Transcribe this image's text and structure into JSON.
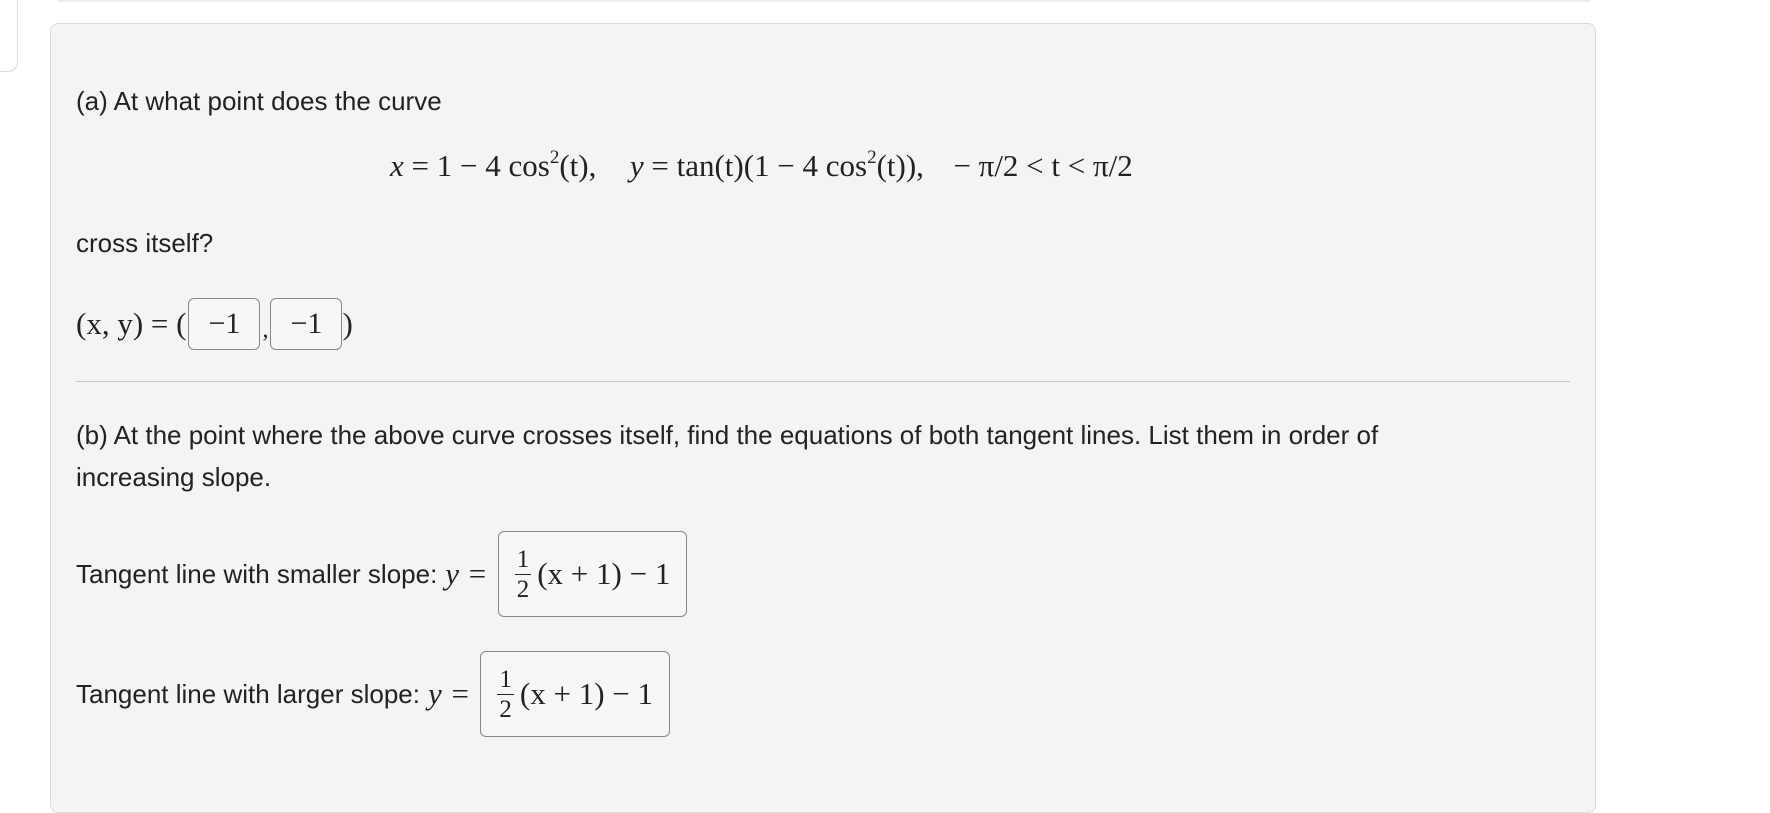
{
  "part_a": {
    "intro": "(a) At what point does the curve",
    "equation": {
      "x_lhs": "x",
      "x_rhs": "= 1 − 4 cos",
      "exp": "2",
      "arg": "(t),",
      "y_lhs": "y",
      "y_rhs": "= tan(t)(1 − 4 cos",
      "y_exp": "2",
      "y_tail": "(t)),",
      "range": "− π/2 < t < π/2"
    },
    "question_end": "cross itself?",
    "answer_label": "(x, y) = (",
    "answer_close": ")",
    "x_value": "−1",
    "separator": ",",
    "y_value": "−1"
  },
  "part_b": {
    "intro": "(b) At the point where the above curve crosses itself, find the equations of both tangent lines. List them in order of",
    "intro_line2": "increasing slope.",
    "smaller": {
      "label": "Tangent line with smaller slope:",
      "var": "y =",
      "frac_num": "1",
      "frac_den": "2",
      "expr": "(x + 1) − 1"
    },
    "larger": {
      "label": "Tangent line with larger slope:",
      "var": "y =",
      "frac_num": "1",
      "frac_den": "2",
      "expr": "(x + 1) − 1"
    }
  }
}
